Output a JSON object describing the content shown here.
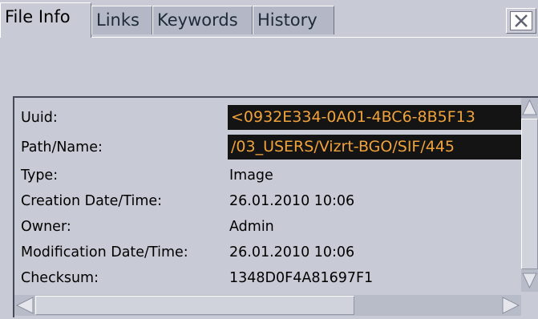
{
  "tabs": [
    {
      "label": "File Info",
      "active": true
    },
    {
      "label": "Links",
      "active": false
    },
    {
      "label": "Keywords",
      "active": false
    },
    {
      "label": "History",
      "active": false
    }
  ],
  "properties": [
    {
      "label": "Uuid:",
      "value": "<0932E334-0A01-4BC6-8B5F13",
      "editable": true
    },
    {
      "label": "Path/Name:",
      "value": "/03_USERS/Vizrt-BGO/SIF/445",
      "editable": true
    },
    {
      "label": "Type:",
      "value": "Image",
      "editable": false
    },
    {
      "label": "Creation Date/Time:",
      "value": "26.01.2010 10:06",
      "editable": false
    },
    {
      "label": "Owner:",
      "value": "Admin",
      "editable": false
    },
    {
      "label": "Modification Date/Time:",
      "value": "26.01.2010 10:06",
      "editable": false
    },
    {
      "label": "Checksum:",
      "value": "1348D0F4A81697F1",
      "editable": false
    }
  ],
  "icons": {
    "close": "close-icon",
    "scroll_up": "arrow-up-icon",
    "scroll_down": "arrow-down-icon",
    "scroll_left": "arrow-left-icon",
    "scroll_right": "arrow-right-icon"
  },
  "colors": {
    "background": "#c8cbd6",
    "inactive_tab": "#b4b8c6",
    "field_bg": "#141414",
    "field_text": "#f0a33c"
  }
}
